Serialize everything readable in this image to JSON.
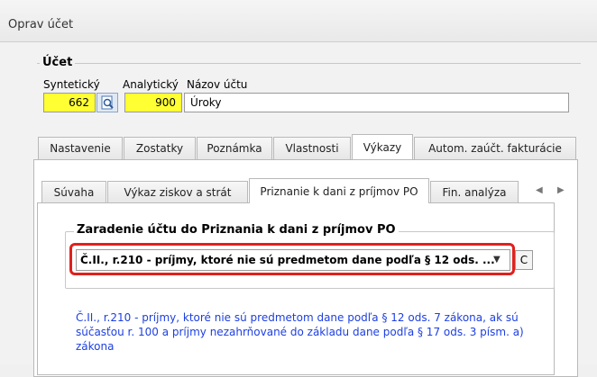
{
  "window": {
    "title": "Oprav účet"
  },
  "account": {
    "group_label": "Účet",
    "synthetic_label": "Syntetický",
    "analytic_label": "Analytický",
    "name_label": "Názov účtu",
    "synthetic_value": "662",
    "analytic_value": "900",
    "name_value": "Úroky",
    "lookup_icon": "search-document-icon"
  },
  "main_tabs": [
    {
      "label": "Nastavenie"
    },
    {
      "label": "Zostatky"
    },
    {
      "label": "Poznámka"
    },
    {
      "label": "Vlastnosti"
    },
    {
      "label": "Výkazy"
    },
    {
      "label": "Autom. zaúčt. fakturácie"
    }
  ],
  "active_main_tab": "Výkazy",
  "sub_tabs": [
    {
      "label": "Súvaha"
    },
    {
      "label": "Výkaz ziskov a strát"
    },
    {
      "label": "Priznanie k dani z príjmov PO"
    },
    {
      "label": "Fin. analýza"
    }
  ],
  "active_sub_tab": "Priznanie k dani z príjmov PO",
  "tax_section": {
    "legend": "Zaradenie účtu do Priznania k dani z príjmov PO",
    "combo_value": "Č.II., r.210 - príjmy, ktoré nie sú predmetom dane podľa § 12 ods. ...",
    "clear_button": "C",
    "description": "Č.II., r.210 - príjmy, ktoré nie sú predmetom dane podľa § 12 ods. 7 zákona, ak sú súčasťou r. 100 a príjmy nezahrňované do základu dane podľa § 17 ods. 3 písm. a) zákona"
  },
  "colors": {
    "highlight": "#e0201c",
    "field_yellow": "#ffff33",
    "description_text": "#1d3fe0"
  }
}
